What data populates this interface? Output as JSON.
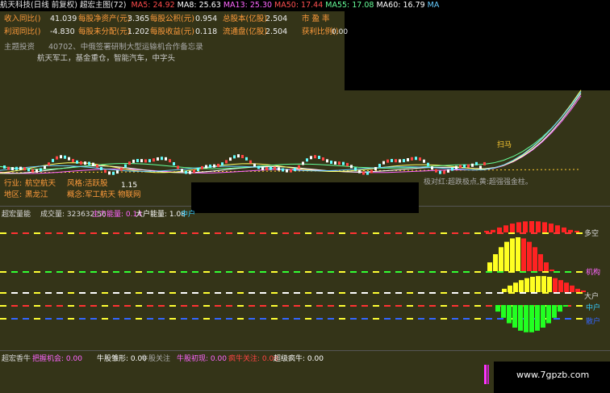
{
  "header": {
    "title": "航天科技(日线 前复权) 超宏主图(72)",
    "ma": [
      {
        "label": "MA5: 24.92",
        "color": "#ff4b4b"
      },
      {
        "label": "MA8: 25.63",
        "color": "#ffffff"
      },
      {
        "label": "MA13: 25.30",
        "color": "#ff66ff"
      },
      {
        "label": "MA50: 17.44",
        "color": "#ff5050"
      },
      {
        "label": "MA55: 17.08",
        "color": "#66ff99"
      },
      {
        "label": "MA60: 16.79",
        "color": "#ffffff"
      },
      {
        "label": "MA",
        "color": "#66ccff"
      }
    ]
  },
  "info": {
    "r1": {
      "l1": "收入同比()",
      "v1": "41.039",
      "l2": "每股净资产(元)",
      "v2": "3.365",
      "l3": "每股公积(元)",
      "v3": "0.954",
      "l4": "总股本(亿股)",
      "v4": "2.504",
      "l5": "市  盈  率",
      "v5": ""
    },
    "r2": {
      "l1": "利润同比()",
      "v1": "-4.830",
      "l2": "每股未分配(元)",
      "v2": "1.202",
      "l3": "每股收益(元)",
      "v3": "0.118",
      "l4": "流通盘(亿股)",
      "v4": "2.504",
      "l5": "获利比例()",
      "v5": "0.00"
    },
    "theme_label": "主题投资",
    "theme_1": "40702、中俄签署研制大型运输机合作备忘录",
    "theme_2": "航天军工，基金重仓，智能汽车，中字头"
  },
  "tags": {
    "industry_label": "行业:",
    "industry": "航空航天",
    "style_label": "风格:",
    "style": "活跃股",
    "region_label": "地区:",
    "region": "黑龙江",
    "concept_label": "概念:",
    "concept": "军工航天 物联网"
  },
  "annotations": {
    "low": "1.15",
    "note_right": "极对红:超跌极点,黄:超强强金柱。",
    "gold": "扫马"
  },
  "indicator": {
    "title": "超宏量能",
    "volume_label": "成交量: 323632.56",
    "main_label": "主力能量: 0.14",
    "big_label": "大户能量: 1.08",
    "mid_label": "中户",
    "right_labels": [
      {
        "text": "多空",
        "color": "#ffffff"
      },
      {
        "text": "机构",
        "color": "#ff66ff"
      },
      {
        "text": "大户",
        "color": "#ffffff"
      },
      {
        "text": "中户",
        "color": "#33ccff"
      },
      {
        "text": "散户",
        "color": "#3366ff"
      }
    ]
  },
  "bottom": {
    "title": "超宏香牛",
    "grab": "把握机会: 0.00",
    "bull": "牛股雏形: 0.00",
    "watch": "牛股关注",
    "first": "牛股初现: 0.00",
    "crazy_watch": "疯牛关注: 0.00",
    "super": "超级疯牛: 0.00",
    "watermark": "www.7gpzb.com"
  },
  "colors": {
    "red": "#ff2222",
    "yellow": "#ffff22",
    "green": "#22ff22",
    "gold": "#ffcc33"
  }
}
